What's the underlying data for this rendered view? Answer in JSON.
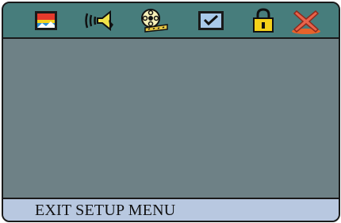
{
  "menu": {
    "tabs": [
      {
        "icon": "picture-icon",
        "selected": false
      },
      {
        "icon": "speaker-icon",
        "selected": false
      },
      {
        "icon": "film-reel-icon",
        "selected": false
      },
      {
        "icon": "checkbox-monitor-icon",
        "selected": false
      },
      {
        "icon": "padlock-icon",
        "selected": false
      },
      {
        "icon": "exit-x-icon",
        "selected": true
      }
    ]
  },
  "status": {
    "text": "EXIT SETUP MENU"
  },
  "colors": {
    "topbar": "#477d7c",
    "content": "#6e8186",
    "statusbar": "#b8c8e0",
    "accent": "#e8632a"
  }
}
